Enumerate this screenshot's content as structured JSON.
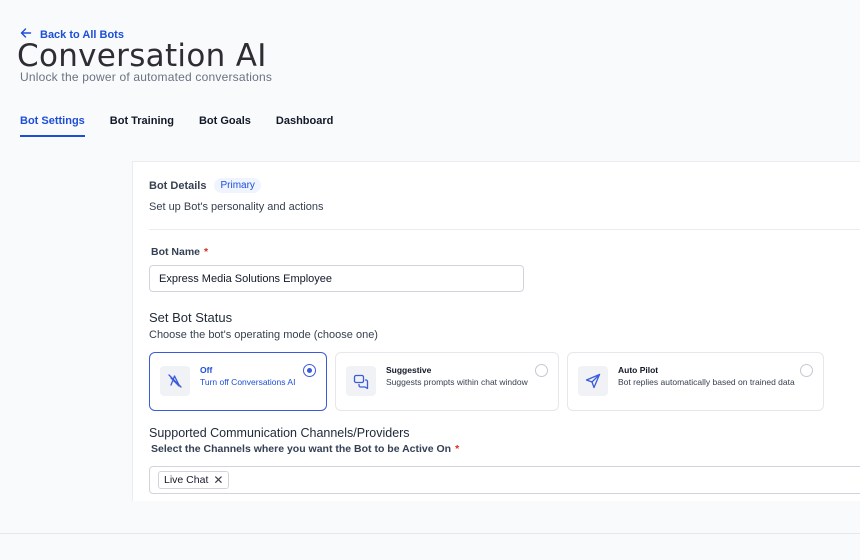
{
  "header": {
    "back_label": "Back to All Bots",
    "title": "Conversation AI",
    "subtitle": "Unlock the power of automated conversations"
  },
  "tabs": [
    {
      "label": "Bot Settings",
      "active": true
    },
    {
      "label": "Bot Training",
      "active": false
    },
    {
      "label": "Bot Goals",
      "active": false
    },
    {
      "label": "Dashboard",
      "active": false
    }
  ],
  "bot_details": {
    "title": "Bot Details",
    "badge": "Primary",
    "description": "Set up Bot's personality and actions"
  },
  "bot_name": {
    "label": "Bot Name",
    "required_mark": "*",
    "value": "Express Media Solutions Employee"
  },
  "bot_status": {
    "title": "Set Bot Status",
    "description": "Choose the bot's operating mode (choose one)",
    "modes": [
      {
        "title": "Off",
        "description": "Turn off Conversations AI",
        "icon": "bot-off-icon",
        "selected": true
      },
      {
        "title": "Suggestive",
        "description": "Suggests prompts within chat window",
        "icon": "chat-suggest-icon",
        "selected": false
      },
      {
        "title": "Auto Pilot",
        "description": "Bot replies automatically based on trained data",
        "icon": "send-icon",
        "selected": false
      }
    ]
  },
  "channels": {
    "title": "Supported Communication Channels/Providers",
    "label": "Select the Channels where you want the Bot to be Active On",
    "required_mark": "*",
    "selected": [
      "Live Chat"
    ],
    "remove_glyph": "✕"
  },
  "colors": {
    "accent": "#1d4ed8",
    "selected_border": "#3b5bdb",
    "required": "#d92d20",
    "badge_bg": "#eff4ff"
  }
}
